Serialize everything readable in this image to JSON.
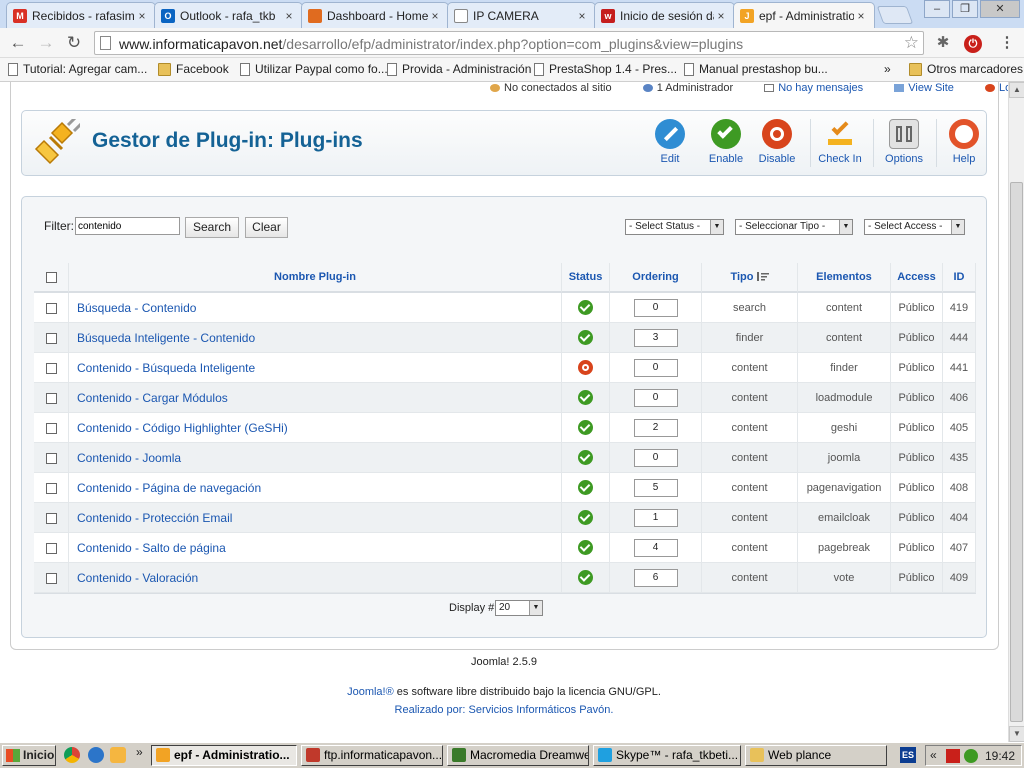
{
  "browser": {
    "tabs": [
      {
        "label": "Recibidos - rafasim",
        "icon": "gmail-icon",
        "color": "#d93025",
        "glyph": "M"
      },
      {
        "label": "Outlook - rafa_tkb",
        "icon": "outlook-icon",
        "color": "#0a64c2",
        "glyph": "O"
      },
      {
        "label": "Dashboard - Home",
        "icon": "dashboard-icon",
        "color": "#e06b1f",
        "glyph": ""
      },
      {
        "label": "IP CAMERA",
        "icon": "page-icon",
        "color": "#ffffff",
        "glyph": ""
      },
      {
        "label": "Inicio de sesión da",
        "icon": "site-icon",
        "color": "#c51d1d",
        "glyph": "w"
      },
      {
        "label": "epf - Administratio",
        "icon": "joomla-icon",
        "color": "#f2a324",
        "glyph": "J"
      }
    ],
    "url_host": "www.informaticapavon.net",
    "url_path": "/desarrollo/efp/administrator/index.php?option=com_plugins&view=plugins",
    "bookmarks": [
      {
        "label": "Tutorial: Agregar cam...",
        "icon": "page"
      },
      {
        "label": "Facebook",
        "icon": "folder"
      },
      {
        "label": "Utilizar Paypal como fo...",
        "icon": "page"
      },
      {
        "label": "Provida - Administración",
        "icon": "page"
      },
      {
        "label": "PrestaShop 1.4 - Pres...",
        "icon": "page"
      },
      {
        "label": "Manual prestashop bu...",
        "icon": "page"
      }
    ],
    "bookmarks_overflow": "»",
    "other_bookmarks": "Otros marcadores"
  },
  "status_bar": {
    "not_connected": "No conectados al sitio",
    "admins": "1 Administrador",
    "messages": "No hay mensajes",
    "view_site": "View Site",
    "logout": "Log out"
  },
  "header": {
    "title": "Gestor de Plug-in: Plug-ins",
    "tools": [
      {
        "label": "Edit",
        "icon": "edit-icon"
      },
      {
        "label": "Enable",
        "icon": "enable-icon"
      },
      {
        "label": "Disable",
        "icon": "disable-icon"
      },
      {
        "label": "Check In",
        "icon": "checkin-icon"
      },
      {
        "label": "Options",
        "icon": "options-icon"
      },
      {
        "label": "Help",
        "icon": "help-icon"
      }
    ]
  },
  "filter": {
    "label": "Filter:",
    "value": "contenido",
    "search_label": "Search",
    "clear_label": "Clear",
    "status_select": "- Select Status -",
    "type_select": "- Seleccionar Tipo -",
    "access_select": "- Select Access -"
  },
  "table": {
    "columns": [
      "Nombre Plug-in",
      "Status",
      "Ordering",
      "Tipo",
      "Elementos",
      "Access",
      "ID"
    ],
    "rows": [
      {
        "name": "Búsqueda - Contenido",
        "status": "enabled",
        "ordering": "0",
        "tipo": "search",
        "elemento": "content",
        "access": "Público",
        "id": "419"
      },
      {
        "name": "Búsqueda Inteligente - Contenido",
        "status": "enabled",
        "ordering": "3",
        "tipo": "finder",
        "elemento": "content",
        "access": "Público",
        "id": "444"
      },
      {
        "name": "Contenido - Búsqueda Inteligente",
        "status": "disabled",
        "ordering": "0",
        "tipo": "content",
        "elemento": "finder",
        "access": "Público",
        "id": "441"
      },
      {
        "name": "Contenido - Cargar Módulos",
        "status": "enabled",
        "ordering": "0",
        "tipo": "content",
        "elemento": "loadmodule",
        "access": "Público",
        "id": "406"
      },
      {
        "name": "Contenido - Código Highlighter (GeSHi)",
        "status": "enabled",
        "ordering": "2",
        "tipo": "content",
        "elemento": "geshi",
        "access": "Público",
        "id": "405"
      },
      {
        "name": "Contenido - Joomla",
        "status": "enabled",
        "ordering": "0",
        "tipo": "content",
        "elemento": "joomla",
        "access": "Público",
        "id": "435"
      },
      {
        "name": "Contenido - Página de navegación",
        "status": "enabled",
        "ordering": "5",
        "tipo": "content",
        "elemento": "pagenavigation",
        "access": "Público",
        "id": "408"
      },
      {
        "name": "Contenido - Protección Email",
        "status": "enabled",
        "ordering": "1",
        "tipo": "content",
        "elemento": "emailcloak",
        "access": "Público",
        "id": "404"
      },
      {
        "name": "Contenido - Salto de página",
        "status": "enabled",
        "ordering": "4",
        "tipo": "content",
        "elemento": "pagebreak",
        "access": "Público",
        "id": "407"
      },
      {
        "name": "Contenido - Valoración",
        "status": "enabled",
        "ordering": "6",
        "tipo": "content",
        "elemento": "vote",
        "access": "Público",
        "id": "409"
      }
    ],
    "display_label": "Display #",
    "display_value": "20"
  },
  "footer": {
    "version": "Joomla! 2.5.9",
    "license_link": "Joomla!®",
    "license_text": " es software libre distribuido bajo la licencia GNU/GPL.",
    "credit_prefix": "Realizado por: ",
    "credit_link": "Servicios Informáticos Pavón."
  },
  "taskbar": {
    "start": "Inicio",
    "items": [
      {
        "label": "epf - Administratio...",
        "color": "#f2a324",
        "active": true
      },
      {
        "label": "ftp.informaticapavon....",
        "color": "#c0392b",
        "active": false
      },
      {
        "label": "Macromedia Dreamwe...",
        "color": "#3a7a2a",
        "active": false
      },
      {
        "label": "Skype™ - rafa_tkbeti...",
        "color": "#1fa0e0",
        "active": false
      },
      {
        "label": "Web plance",
        "color": "#e8c15a",
        "active": false
      }
    ],
    "lang": "ES",
    "clock": "19:42"
  },
  "colors": {
    "title_blue": "#146295",
    "link_blue": "#1b57b1",
    "enabled_green": "#3e9a23",
    "disabled_red": "#d8441c"
  }
}
